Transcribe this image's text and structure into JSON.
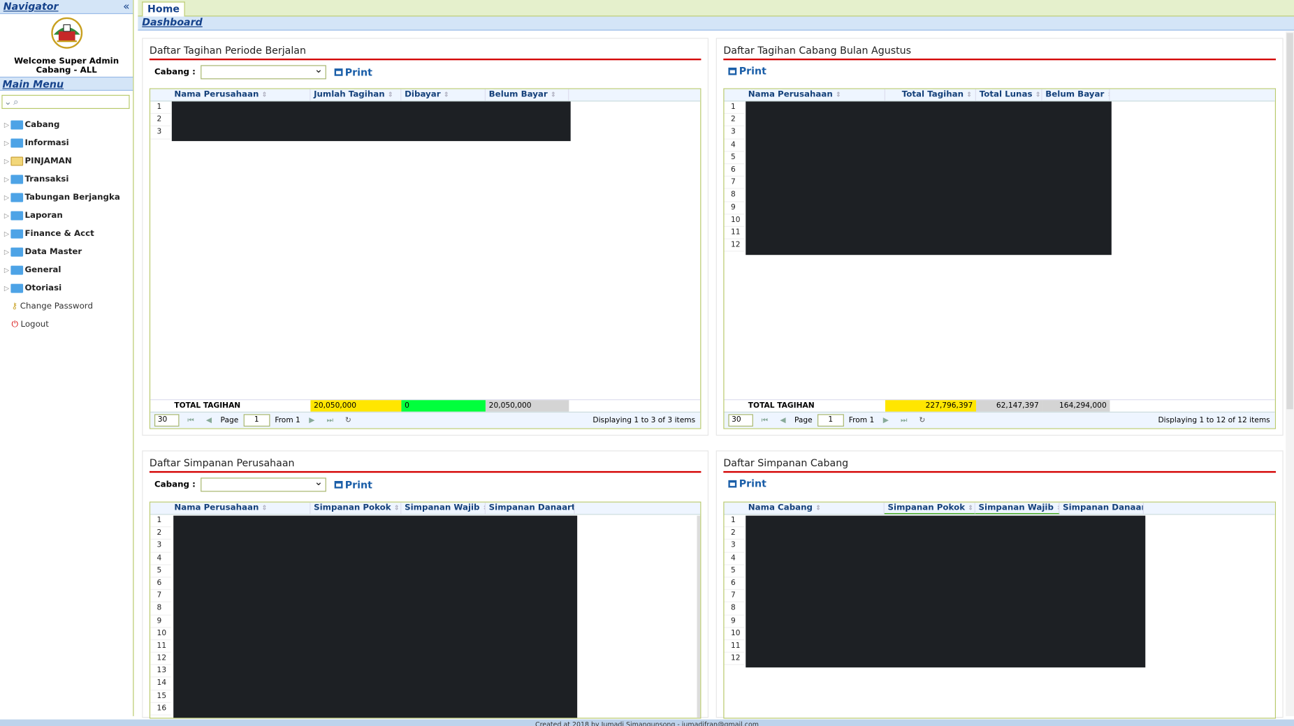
{
  "navigator": {
    "title": "Navigator",
    "collapse_icon": "«"
  },
  "welcome": {
    "line1": "Welcome Super Admin",
    "line2": "Cabang - ALL"
  },
  "main_menu": {
    "title": "Main Menu",
    "search_placeholder": "",
    "items": [
      {
        "label": "Cabang",
        "icon": "folder-icon"
      },
      {
        "label": "Informasi",
        "icon": "folder-icon"
      },
      {
        "label": "PINJAMAN",
        "icon": "folder-open-icon"
      },
      {
        "label": "Transaksi",
        "icon": "folder-icon"
      },
      {
        "label": "Tabungan Berjangka",
        "icon": "folder-icon"
      },
      {
        "label": "Laporan",
        "icon": "folder-icon"
      },
      {
        "label": "Finance & Acct",
        "icon": "folder-icon"
      },
      {
        "label": "Data Master",
        "icon": "folder-icon"
      },
      {
        "label": "General",
        "icon": "folder-icon"
      },
      {
        "label": "Otoriasi",
        "icon": "folder-icon"
      }
    ],
    "links": [
      {
        "label": "Change Password",
        "icon": "key-icon"
      },
      {
        "label": "Logout",
        "icon": "power-icon"
      }
    ]
  },
  "tabs": [
    {
      "label": "Home"
    }
  ],
  "breadcrumb": "Dashboard",
  "panels": {
    "tagihan_periode": {
      "title": "Daftar Tagihan Periode Berjalan",
      "filter_label": "Cabang :",
      "print_label": "Print",
      "columns": [
        "Nama Perusahaan",
        "Jumlah Tagihan",
        "Dibayar",
        "Belum Bayar"
      ],
      "rows": [
        "1",
        "2",
        "3"
      ],
      "totals": {
        "label": "TOTAL TAGIHAN",
        "jumlah": "20,050,000",
        "dibayar": "0",
        "belum": "20,050,000"
      },
      "pager": {
        "size": "30",
        "page_label": "Page",
        "page": "1",
        "from": "From 1",
        "info": "Displaying 1 to 3 of 3 items"
      }
    },
    "tagihan_cabang": {
      "title": "Daftar Tagihan Cabang Bulan Agustus",
      "print_label": "Print",
      "columns": [
        "Nama Perusahaan",
        "Total Tagihan",
        "Total Lunas",
        "Belum Bayar"
      ],
      "rows": [
        "1",
        "2",
        "3",
        "4",
        "5",
        "6",
        "7",
        "8",
        "9",
        "10",
        "11",
        "12"
      ],
      "totals": {
        "label": "TOTAL TAGIHAN",
        "total": "227,796,397",
        "lunas": "62,147,397",
        "belum": "164,294,000"
      },
      "pager": {
        "size": "30",
        "page_label": "Page",
        "page": "1",
        "from": "From 1",
        "info": "Displaying 1 to 12 of 12 items"
      }
    },
    "simpanan_perusahaan": {
      "title": "Daftar Simpanan Perusahaan",
      "filter_label": "Cabang :",
      "print_label": "Print",
      "columns": [
        "Nama Perusahaan",
        "Simpanan Pokok",
        "Simpanan Wajib",
        "Simpanan Danaarta"
      ],
      "rows": [
        "1",
        "2",
        "3",
        "4",
        "5",
        "6",
        "7",
        "8",
        "9",
        "10",
        "11",
        "12",
        "13",
        "14",
        "15",
        "16"
      ]
    },
    "simpanan_cabang": {
      "title": "Daftar Simpanan Cabang",
      "print_label": "Print",
      "columns": [
        "Nama Cabang",
        "Simpanan Pokok",
        "Simpanan Wajib",
        "Simpanan Danaar..."
      ],
      "rows": [
        "1",
        "2",
        "3",
        "4",
        "5",
        "6",
        "7",
        "8",
        "9",
        "10",
        "11",
        "12"
      ]
    }
  },
  "colors": {
    "accent": "#15428b",
    "title_rule": "#d40000",
    "total_yellow": "#ffe600",
    "total_green": "#00ff3c",
    "total_gray": "#d4d4d4"
  },
  "footer": "Created at 2018 by Jumadi Simangunsong - jumadifran@gmail.com"
}
